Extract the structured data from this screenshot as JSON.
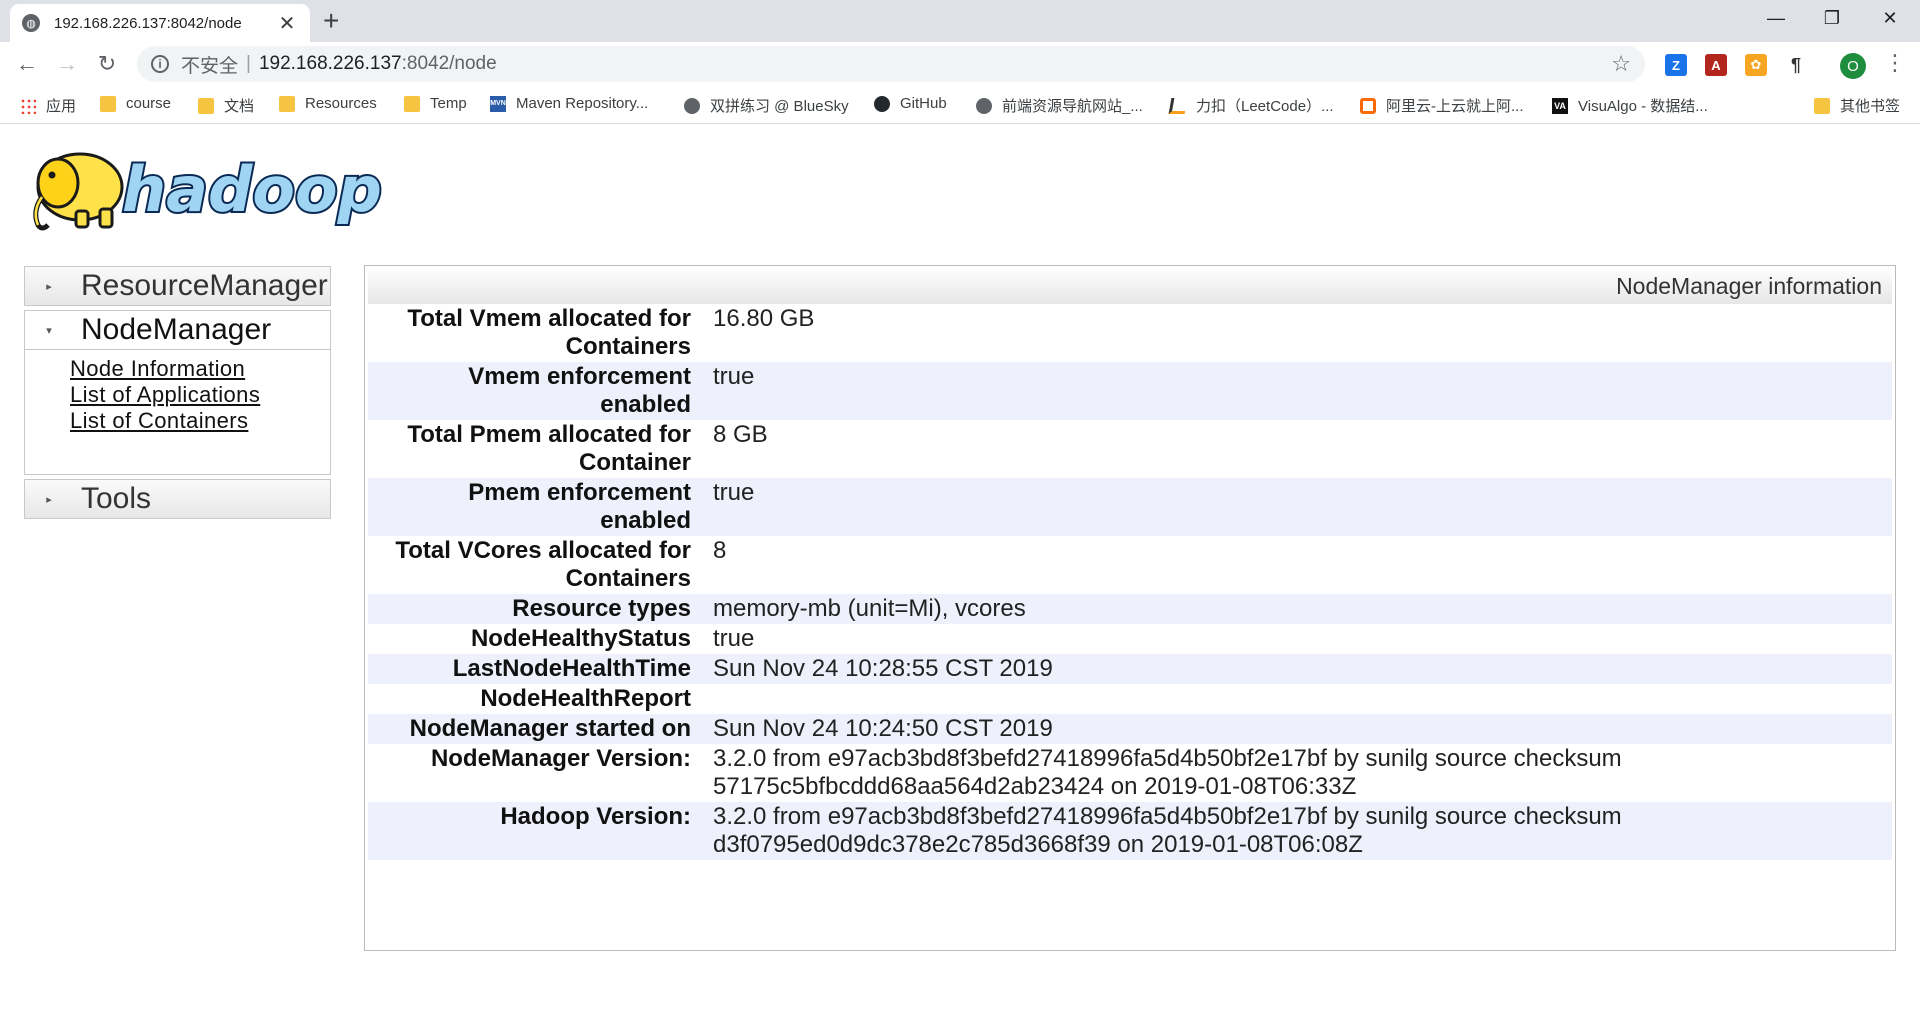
{
  "browser": {
    "tab_title": "192.168.226.137:8042/node",
    "close_symbol": "✕",
    "new_tab_symbol": "+",
    "minimize_symbol": "—",
    "restore_symbol": "❐",
    "window_close_symbol": "✕",
    "back_symbol": "←",
    "forward_symbol": "→",
    "reload_symbol": "↻",
    "address": {
      "info_symbol": "i",
      "insecure_label": "不安全",
      "separator": "|",
      "host": "192.168.226.137",
      "path": ":8042/node",
      "star_symbol": "☆"
    },
    "profile_initial": "O",
    "menu_symbol": "⋮",
    "bookmarks": [
      {
        "label": "应用",
        "icon": "apps-grid-icon"
      },
      {
        "label": "course",
        "icon": "folder-icon"
      },
      {
        "label": "文档",
        "icon": "folder-icon"
      },
      {
        "label": "Resources",
        "icon": "folder-icon"
      },
      {
        "label": "Temp",
        "icon": "folder-icon"
      },
      {
        "label": "Maven Repository...",
        "icon": "maven-icon"
      },
      {
        "label": "双拼练习 @ BlueSky",
        "icon": "globe-icon"
      },
      {
        "label": "GitHub",
        "icon": "github-icon"
      },
      {
        "label": "前端资源导航网站_...",
        "icon": "globe-icon"
      },
      {
        "label": "力扣（LeetCode）...",
        "icon": "leetcode-icon"
      },
      {
        "label": "阿里云-上云就上阿...",
        "icon": "aliyun-icon"
      },
      {
        "label": "VisuAlgo - 数据结...",
        "icon": "visualgo-icon"
      },
      {
        "label": "其他书签",
        "icon": "folder-icon"
      }
    ],
    "mvn_badge": "MVN",
    "va_badge": "VA"
  },
  "logo": {
    "text": "hadoop"
  },
  "nav": {
    "sections": [
      {
        "label": "ResourceManager",
        "arrow": "▸"
      },
      {
        "label": "NodeManager",
        "arrow": "▾"
      },
      {
        "label": "Tools",
        "arrow": "▸"
      }
    ],
    "links": [
      "Node Information",
      "List of Applications",
      "List of Containers"
    ]
  },
  "panel": {
    "title": "NodeManager information",
    "rows": [
      {
        "label": "Total Vmem allocated for Containers",
        "value": "16.80 GB"
      },
      {
        "label": "Vmem enforcement enabled",
        "value": "true"
      },
      {
        "label": "Total Pmem allocated for Container",
        "value": "8 GB"
      },
      {
        "label": "Pmem enforcement enabled",
        "value": "true"
      },
      {
        "label": "Total VCores allocated for Containers",
        "value": "8"
      },
      {
        "label": "Resource types",
        "value": "memory-mb (unit=Mi), vcores"
      },
      {
        "label": "NodeHealthyStatus",
        "value": "true"
      },
      {
        "label": "LastNodeHealthTime",
        "value": "Sun Nov 24 10:28:55 CST 2019"
      },
      {
        "label": "NodeHealthReport",
        "value": ""
      },
      {
        "label": "NodeManager started on",
        "value": "Sun Nov 24 10:24:50 CST 2019"
      },
      {
        "label": "NodeManager Version:",
        "value": "3.2.0 from e97acb3bd8f3befd27418996fa5d4b50bf2e17bf by sunilg source checksum 57175c5bfbcddd68aa564d2ab23424 on 2019-01-08T06:33Z"
      },
      {
        "label": "Hadoop Version:",
        "value": "3.2.0 from e97acb3bd8f3befd27418996fa5d4b50bf2e17bf by sunilg source checksum d3f0795ed0d9dc378e2c785d3668f39 on 2019-01-08T06:08Z"
      }
    ]
  }
}
